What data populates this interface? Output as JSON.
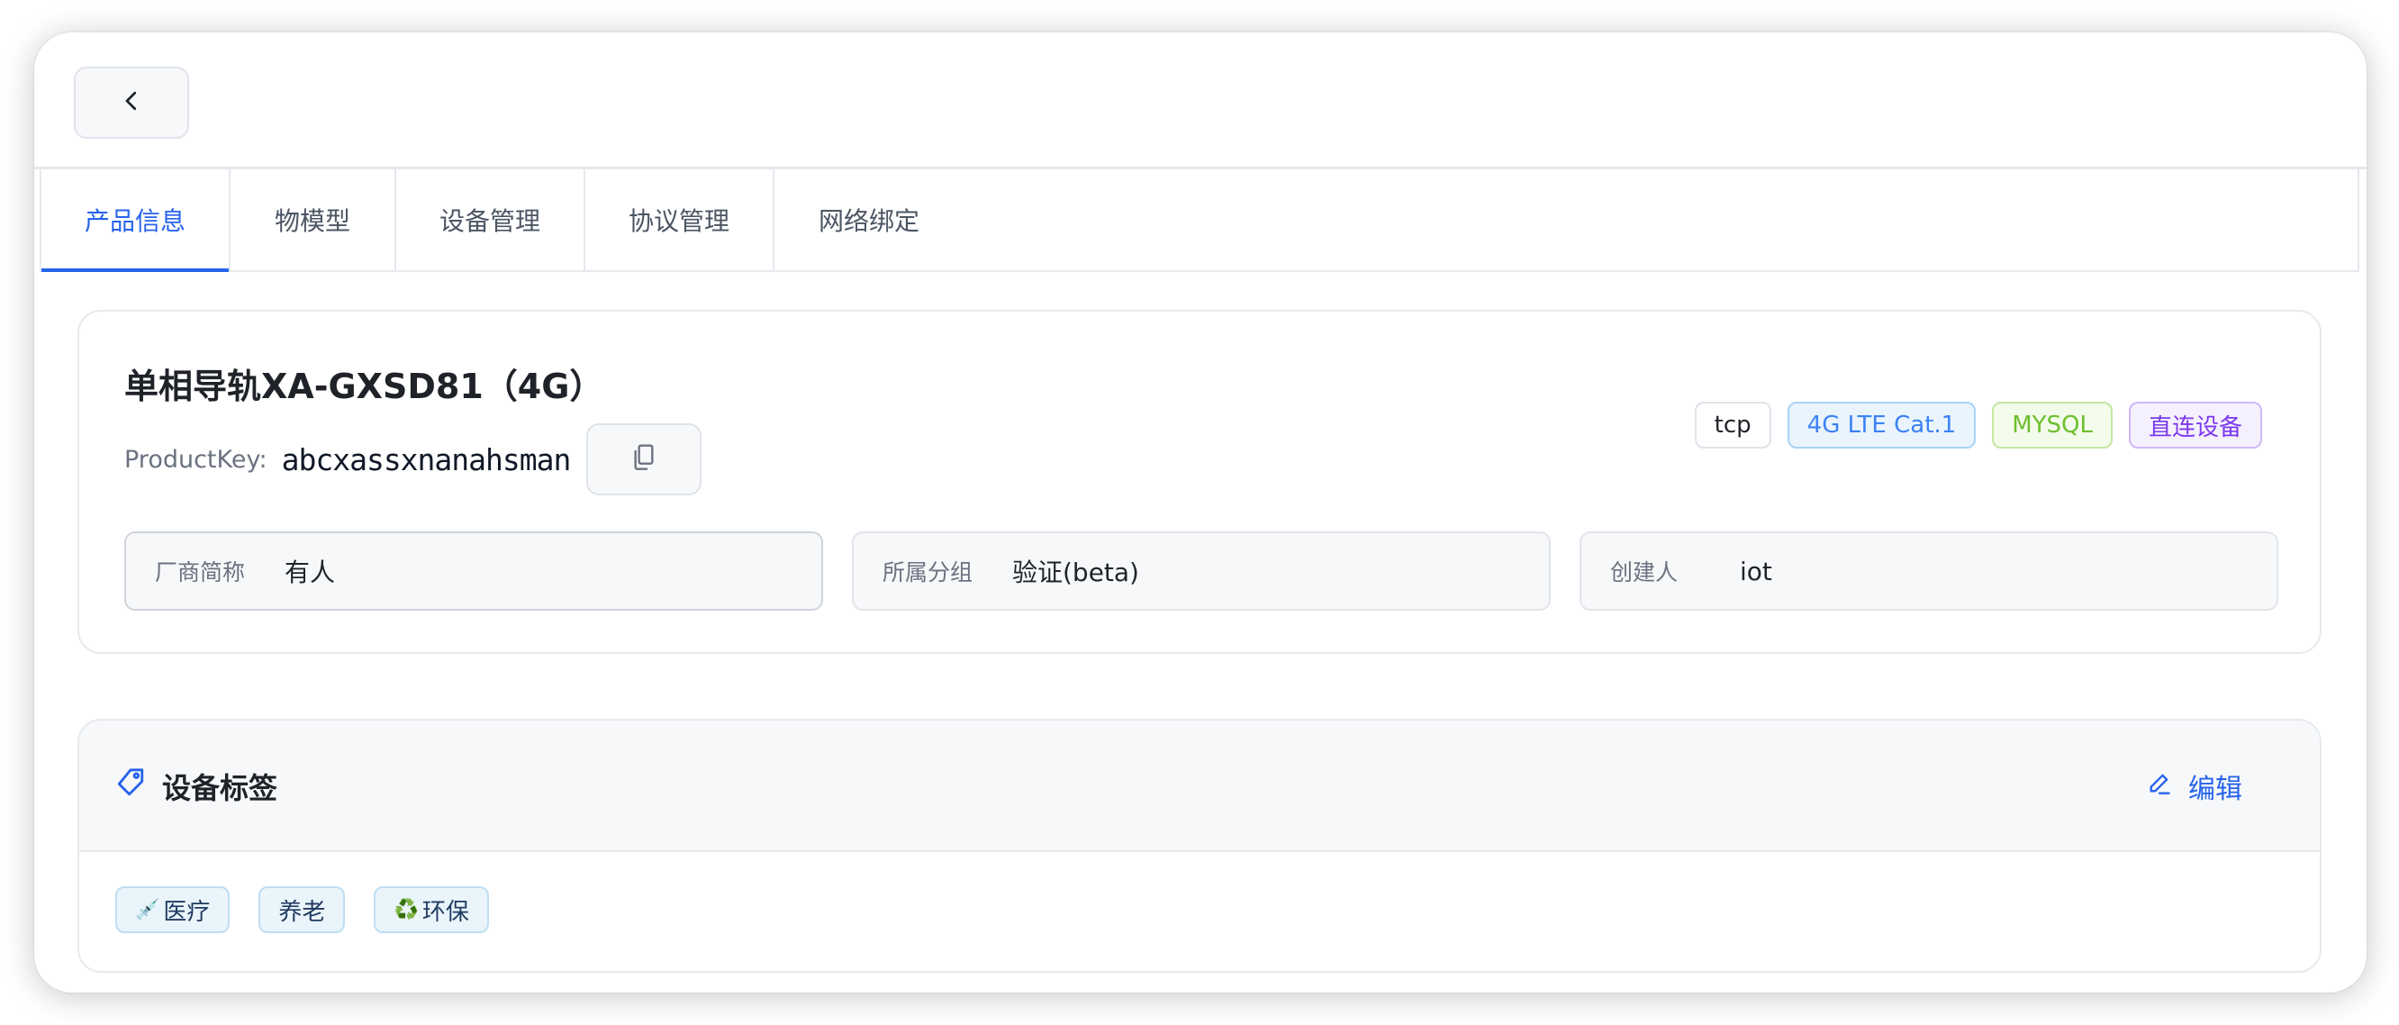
{
  "tabs": [
    {
      "label": "产品信息",
      "active": true
    },
    {
      "label": "物模型",
      "active": false
    },
    {
      "label": "设备管理",
      "active": false
    },
    {
      "label": "协议管理",
      "active": false
    },
    {
      "label": "网络绑定",
      "active": false
    }
  ],
  "product": {
    "title": "单相导轨XA-GXSD81（4G）",
    "product_key_label": "ProductKey:",
    "product_key": "abcxassxnanahsman"
  },
  "badges": [
    {
      "label": "tcp",
      "color": "#1f2329",
      "bg": "#ffffff",
      "border": "#dfe3ea"
    },
    {
      "label": "4G LTE Cat.1",
      "color": "#3b82f6",
      "bg": "#eaf4fd",
      "border": "#a9d3f5"
    },
    {
      "label": "MYSQL",
      "color": "#6cbf2e",
      "bg": "#f3fbea",
      "border": "#c3e6a2"
    },
    {
      "label": "直连设备",
      "color": "#7c3aed",
      "bg": "#f5f0fe",
      "border": "#cfb7f7"
    }
  ],
  "info": [
    {
      "label": "厂商简称",
      "value": "有人"
    },
    {
      "label": "所属分组",
      "value": "验证(beta)"
    },
    {
      "label": "创建人",
      "value": "iot"
    }
  ],
  "tags_section": {
    "title": "设备标签",
    "edit_label": "编辑",
    "tags": [
      {
        "emoji": "💉",
        "text": "医疗"
      },
      {
        "emoji": "",
        "text": "养老"
      },
      {
        "emoji": "♻️",
        "text": "环保"
      }
    ]
  },
  "colors": {
    "accent": "#2563eb"
  },
  "icons": {
    "back": "chevron-left-icon",
    "copy": "copy-icon",
    "tag": "tag-icon",
    "edit": "pencil-icon"
  }
}
